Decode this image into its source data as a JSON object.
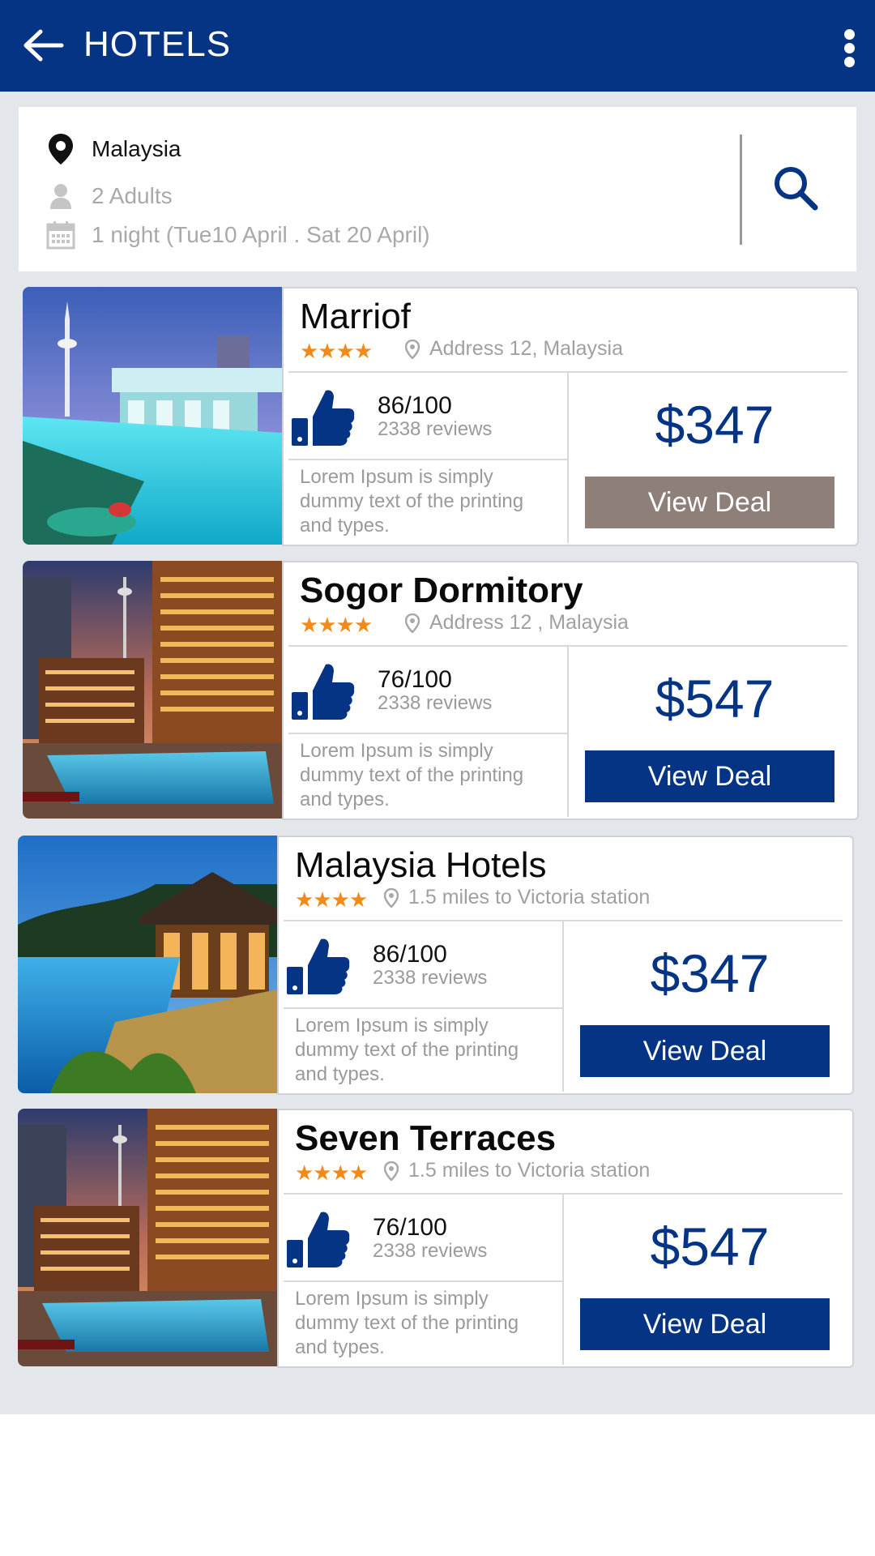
{
  "appbar": {
    "title": "HOTELS",
    "back_icon": "arrow-left-icon",
    "menu_icon": "more-vertical-icon"
  },
  "search": {
    "location": "Malaysia",
    "guests": "2 Adults",
    "dates": "1 night (Tue10 April . Sat 20 April)",
    "search_icon": "search-icon"
  },
  "colors": {
    "primary": "#053485",
    "star": "#f28a1a",
    "deal_highlight": "#8e8079",
    "background": "#e3e6ea"
  },
  "hotels": [
    {
      "name": "Marriof",
      "stars": "★★★★",
      "address": "Address 12, Malaysia",
      "score": "86/100",
      "reviews": "2338 reviews",
      "description": "Lorem Ipsum is simply dummy text of the printing and types.",
      "price": "$347",
      "deal_label": "View Deal"
    },
    {
      "name": "Sogor Dormitory",
      "stars": "★★★★",
      "address": "Address 12 , Malaysia",
      "score": "76/100",
      "reviews": "2338 reviews",
      "description": "Lorem Ipsum is simply dummy text of the printing and types.",
      "price": "$547",
      "deal_label": "View Deal"
    },
    {
      "name": "Malaysia Hotels",
      "stars": "★★★★",
      "address": "1.5 miles to Victoria station",
      "score": "86/100",
      "reviews": "2338 reviews",
      "description": "Lorem Ipsum is simply dummy text of the printing and types.",
      "price": "$347",
      "deal_label": "View Deal"
    },
    {
      "name": "Seven Terraces",
      "stars": "★★★★",
      "address": "1.5 miles to Victoria station",
      "score": "76/100",
      "reviews": "2338 reviews",
      "description": "Lorem Ipsum is simply dummy text of the printing and types.",
      "price": "$547",
      "deal_label": "View Deal"
    }
  ]
}
